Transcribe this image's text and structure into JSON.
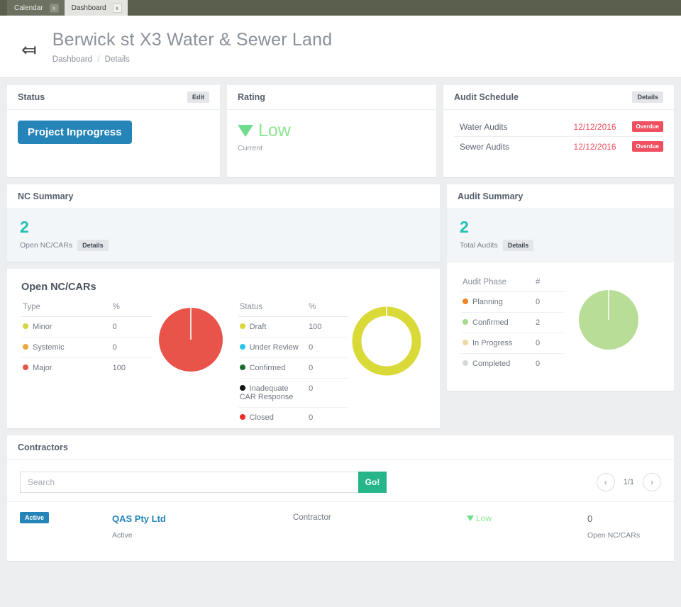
{
  "tabs": [
    {
      "label": "Calendar",
      "close": "x",
      "active": false
    },
    {
      "label": "Dashboard",
      "close": "x",
      "active": true
    }
  ],
  "header": {
    "back_icon": "back-arrow-icon",
    "title": "Berwick st X3 Water & Sewer Land",
    "breadcrumb_root": "Dashboard",
    "breadcrumb_sep": "/",
    "breadcrumb_current": "Details"
  },
  "status_card": {
    "title": "Status",
    "edit_label": "Edit",
    "value": "Project Inprogress",
    "badge_color": "#2585b8"
  },
  "rating_card": {
    "title": "Rating",
    "value": "Low",
    "sub": "Current",
    "color": "#8be68f",
    "arrow_icon": "triangle-down-icon"
  },
  "audit_schedule": {
    "title": "Audit Schedule",
    "details_label": "Details",
    "rows": [
      {
        "name": "Water Audits",
        "date": "12/12/2016",
        "badge": "Overdue"
      },
      {
        "name": "Sewer Audits",
        "date": "12/12/2016",
        "badge": "Overdue"
      }
    ]
  },
  "nc_summary": {
    "title": "NC Summary",
    "count": "2",
    "count_label": "Open NC/CARs",
    "details_label": "Details",
    "section_title": "Open NC/CARs",
    "accent": "#23bfb0"
  },
  "audit_summary": {
    "title": "Audit Summary",
    "count": "2",
    "count_label": "Total Audits",
    "details_label": "Details",
    "accent": "#23bfb0"
  },
  "chart_data": [
    {
      "type": "pie",
      "title": "Open NC/CARs",
      "columns": [
        "Type",
        "%"
      ],
      "categories": [
        "Minor",
        "Systemic",
        "Major"
      ],
      "values": [
        0,
        0,
        100
      ],
      "colors": [
        "#d4d442",
        "#e8a93a",
        "#e8544a"
      ],
      "legend_position": "left",
      "slice_color": "#e8544a"
    },
    {
      "type": "pie",
      "title": "Status",
      "columns": [
        "Status",
        "%"
      ],
      "categories": [
        "Draft",
        "Under Review",
        "Confirmed",
        "Inadequate CAR Response",
        "Closed"
      ],
      "values": [
        100,
        0,
        0,
        0,
        0
      ],
      "colors": [
        "#d9d938",
        "#29c5e8",
        "#1e6b2e",
        "#111111",
        "#ee2d24"
      ],
      "legend_position": "left",
      "donut": true,
      "slice_color": "#d9d938"
    },
    {
      "type": "pie",
      "title": "Audit Phase",
      "columns": [
        "Audit Phase",
        "#"
      ],
      "categories": [
        "Planning",
        "Confirmed",
        "In Progress",
        "Completed"
      ],
      "values": [
        0,
        2,
        0,
        0
      ],
      "colors": [
        "#f58220",
        "#a8d88a",
        "#ead9a0",
        "#d8d8d8"
      ],
      "legend_position": "left",
      "slice_color": "#b8dd96"
    }
  ],
  "contractors": {
    "title": "Contractors",
    "search_placeholder": "Search",
    "search_value": "",
    "go_label": "Go!",
    "prev_icon": "chevron-left-icon",
    "next_icon": "chevron-right-icon",
    "page_count": "1/1",
    "rows": [
      {
        "badge": "Active",
        "name": "QAS Pty Ltd",
        "sub": "Active",
        "role": "Contractor",
        "rating": "Low",
        "nc_count": "0",
        "nc_label": "Open NC/CARs"
      }
    ]
  }
}
